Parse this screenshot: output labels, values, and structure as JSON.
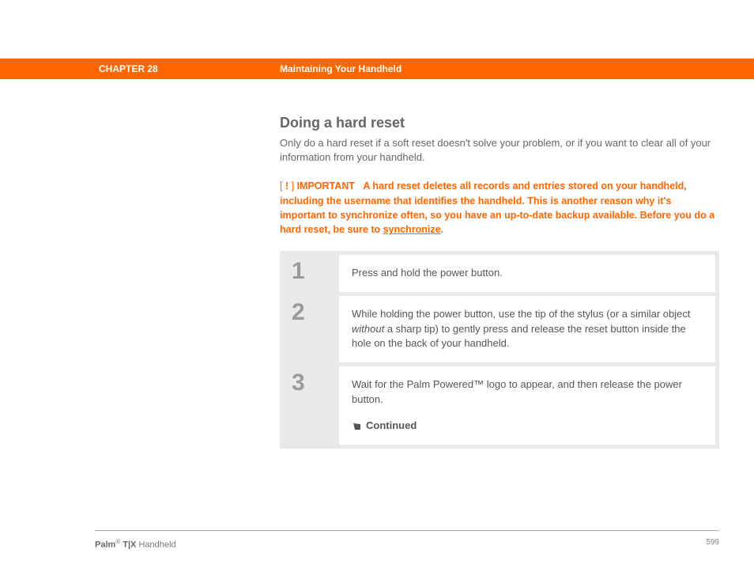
{
  "header": {
    "chapter": "CHAPTER 28",
    "title": "Maintaining Your Handheld"
  },
  "section": {
    "title": "Doing a hard reset",
    "intro": "Only do a hard reset if a soft reset doesn't solve your problem, or if you want to clear all of your information from your handheld."
  },
  "important": {
    "bracket_open": "[",
    "marker": " ! ",
    "bracket_close": "]",
    "label": "IMPORTANT",
    "text_before_link": "A hard reset deletes all records and entries stored on your handheld, including the username that identifies the handheld. This is another reason why it's important to synchronize often, so you have an up-to-date backup available. Before you do a hard reset, be sure to ",
    "link_text": "synchronize",
    "text_after_link": "."
  },
  "steps": [
    {
      "num": "1",
      "text": "Press and hold the power button."
    },
    {
      "num": "2",
      "text_before_em": "While holding the power button, use the tip of the stylus (or a similar object ",
      "em": "without",
      "text_after_em": " a sharp tip) to gently press and release the reset button inside the hole on the back of your handheld."
    },
    {
      "num": "3",
      "text_before_tm": "Wait for the Palm Powered",
      "tm": "™",
      "text_after_tm": " logo to appear, and then release the power button.",
      "continued": "Continued"
    }
  ],
  "footer": {
    "brand": "Palm",
    "reg": "®",
    "model": " T|X",
    "product": " Handheld",
    "page": "599"
  }
}
